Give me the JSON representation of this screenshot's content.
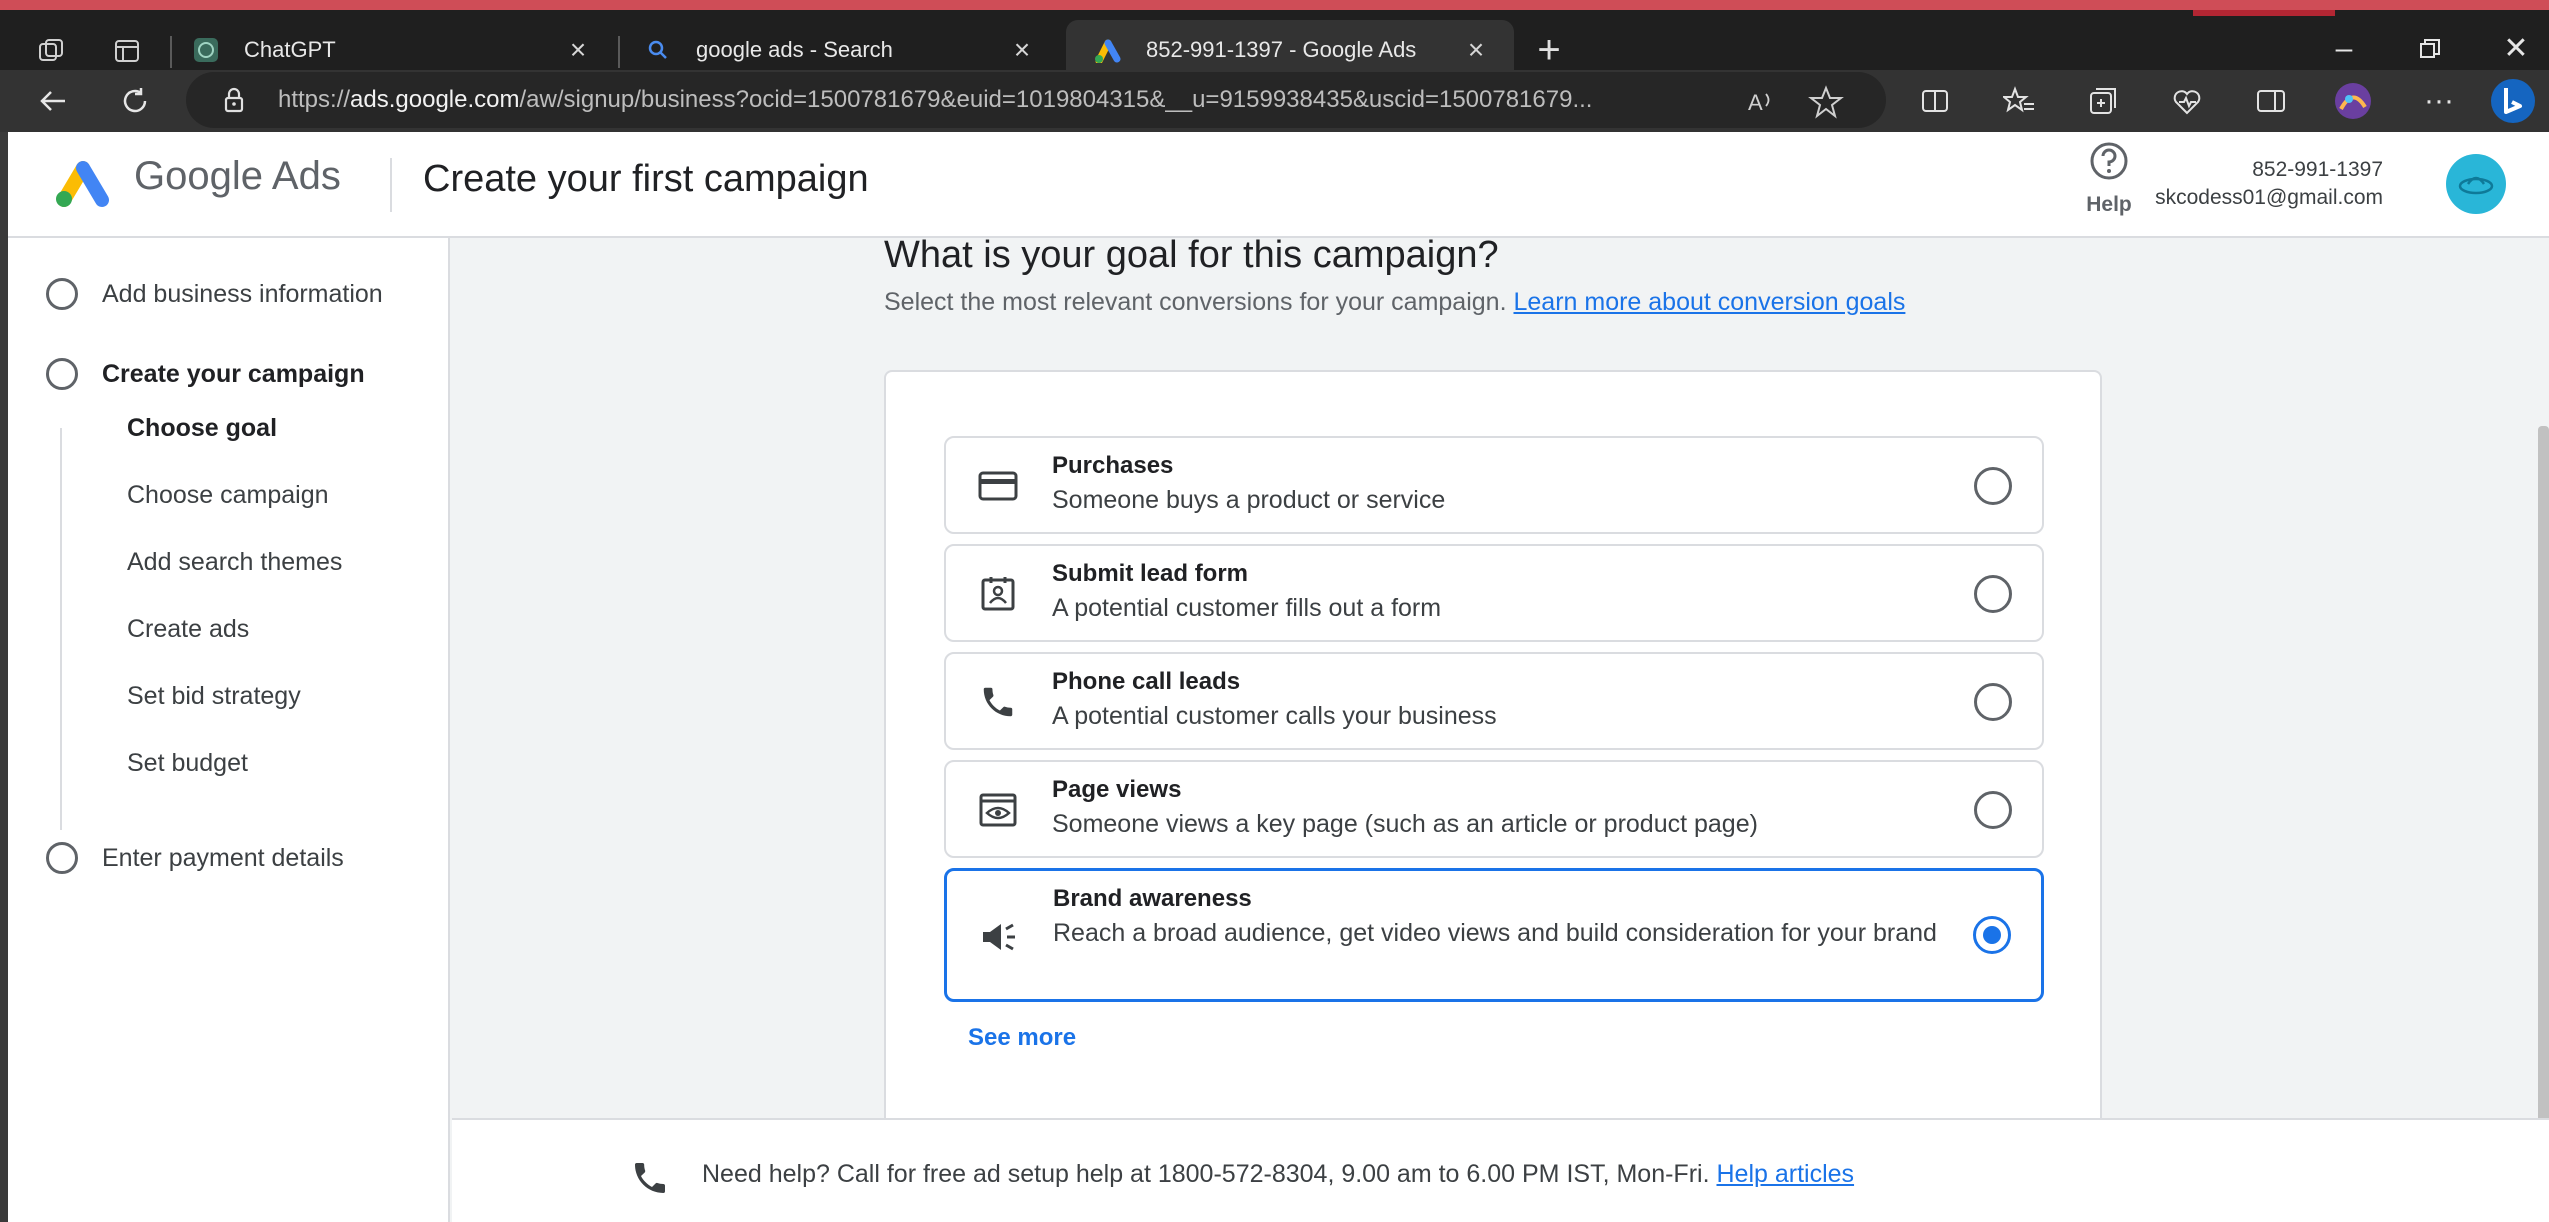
{
  "browser": {
    "tabs": [
      {
        "title": "ChatGPT",
        "favicon": "chatgpt-icon"
      },
      {
        "title": "google ads - Search",
        "favicon": "search-icon"
      },
      {
        "title": "852-991-1397 - Google Ads",
        "favicon": "google-ads-icon",
        "active": true
      }
    ],
    "url_prefix": "https://",
    "url_host": "ads.google.com",
    "url_rest": "/aw/signup/business?ocid=1500781679&euid=1019804315&__u=9159938435&uscid=1500781679..."
  },
  "header": {
    "logo_text": "Google Ads",
    "title": "Create your first campaign",
    "help_label": "Help",
    "account_id": "852-991-1397",
    "account_email": "skcodess01@gmail.com"
  },
  "sidebar": {
    "steps": [
      {
        "label": "Add business information"
      },
      {
        "label": "Create your campaign"
      },
      {
        "label": "Enter payment details"
      }
    ],
    "substeps": [
      {
        "label": "Choose goal"
      },
      {
        "label": "Choose campaign"
      },
      {
        "label": "Add search themes"
      },
      {
        "label": "Create ads"
      },
      {
        "label": "Set bid strategy"
      },
      {
        "label": "Set budget"
      }
    ]
  },
  "main": {
    "heading": "What is your goal for this campaign?",
    "subheading": "Select the most relevant conversions for your campaign.",
    "learn_more": "Learn more about conversion goals",
    "options": [
      {
        "title": "Purchases",
        "desc": "Someone buys a product or service",
        "icon": "credit-card-icon",
        "selected": false
      },
      {
        "title": "Submit lead form",
        "desc": "A potential customer fills out a form",
        "icon": "contact-form-icon",
        "selected": false
      },
      {
        "title": "Phone call leads",
        "desc": "A potential customer calls your business",
        "icon": "phone-icon",
        "selected": false
      },
      {
        "title": "Page views",
        "desc": "Someone views a key page (such as an article or product page)",
        "icon": "eye-page-icon",
        "selected": false
      },
      {
        "title": "Brand awareness",
        "desc": "Reach a broad audience, get video views and build consideration for your brand",
        "icon": "megaphone-icon",
        "selected": true
      }
    ],
    "see_more": "See more"
  },
  "footer": {
    "message": "Need help? Call for free ad setup help at 1800-572-8304, 9.00 am to 6.00 PM IST, Mon-Fri.",
    "link": "Help articles"
  },
  "colors": {
    "accent": "#1a73e8",
    "page_bg": "#f1f3f4",
    "chrome_bg": "#1f1f1f"
  }
}
